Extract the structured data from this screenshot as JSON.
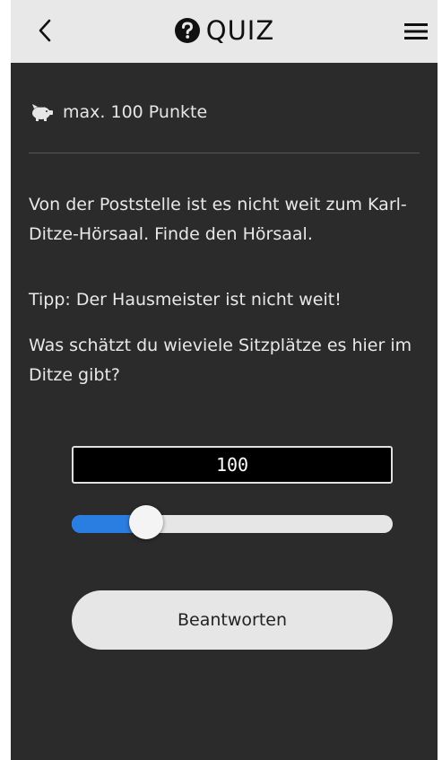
{
  "header": {
    "back_icon": "chevron-left-icon",
    "title_icon": "question-circle-icon",
    "title": "QUIZ",
    "menu_icon": "hamburger-menu-icon"
  },
  "points": {
    "icon": "piggy-bank-icon",
    "label": "max. 100 Punkte"
  },
  "question": {
    "intro": "Von der Poststelle ist es nicht weit zum Karl-Ditze-Hörsaal. Finde den Hörsaal.",
    "tip": "Tipp: Der Hausmeister ist nicht weit!",
    "prompt": "Was schätzt du wieviele Sitzplätze es hier im Ditze gibt?"
  },
  "answer": {
    "value": "100",
    "slider_fraction": 0.2
  },
  "submit": {
    "label": "Beantworten"
  },
  "colors": {
    "background": "#2b2b2b",
    "header": "#e8e8e8",
    "accent": "#2a7de1",
    "button": "#e6e6e6"
  }
}
